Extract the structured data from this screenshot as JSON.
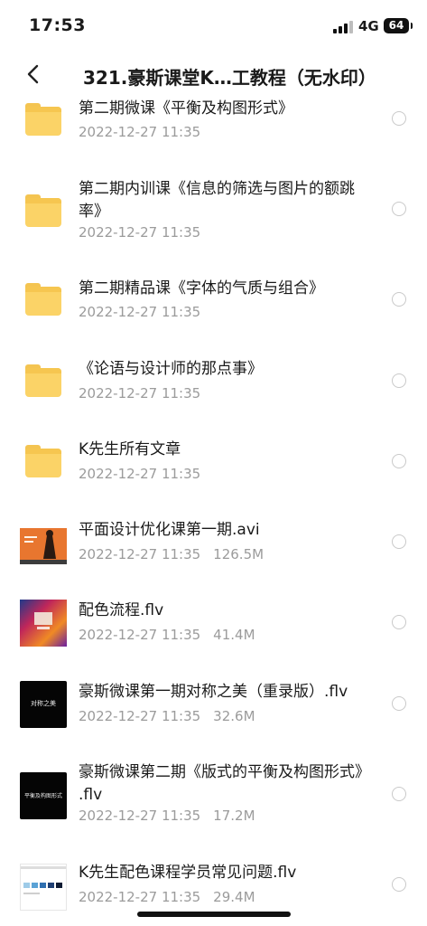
{
  "status_bar": {
    "time": "17:53",
    "network": "4G",
    "battery": "64"
  },
  "header": {
    "title": "321.豪斯课堂K…工教程（无水印）"
  },
  "files": [
    {
      "type": "folder",
      "name": "第二期微课《平衡及构图形式》",
      "date": "2022-12-27 11:35",
      "size": ""
    },
    {
      "type": "folder",
      "name": "第二期内训课《信息的筛选与图片的额跳率》",
      "date": "2022-12-27 11:35",
      "size": ""
    },
    {
      "type": "folder",
      "name": "第二期精品课《字体的气质与组合》",
      "date": "2022-12-27 11:35",
      "size": ""
    },
    {
      "type": "folder",
      "name": "《论语与设计师的那点事》",
      "date": "2022-12-27 11:35",
      "size": ""
    },
    {
      "type": "folder",
      "name": "K先生所有文章",
      "date": "2022-12-27 11:35",
      "size": ""
    },
    {
      "type": "video",
      "thumb": "thumb-orange",
      "name": "平面设计优化课第一期.avi",
      "date": "2022-12-27 11:35",
      "size": "126.5M"
    },
    {
      "type": "video",
      "thumb": "thumb-colorful",
      "name": "配色流程.flv",
      "date": "2022-12-27 11:35",
      "size": "41.4M"
    },
    {
      "type": "video",
      "thumb": "thumb-dark-symmetry",
      "name": "豪斯微课第一期对称之美（重录版）.flv",
      "date": "2022-12-27 11:35",
      "size": "32.6M"
    },
    {
      "type": "video",
      "thumb": "thumb-dark-layout",
      "name": "豪斯微课第二期《版式的平衡及构图形式》 .flv",
      "date": "2022-12-27 11:35",
      "size": "17.2M"
    },
    {
      "type": "video",
      "thumb": "thumb-swatches",
      "name": "K先生配色课程学员常见问题.flv",
      "date": "2022-12-27 11:35",
      "size": "29.4M"
    }
  ],
  "thumb_text": {
    "symmetry": "对称之美",
    "layout": "平衡及构图形式"
  }
}
